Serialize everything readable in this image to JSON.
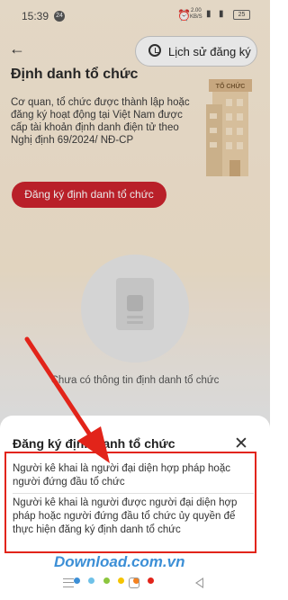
{
  "status_bar": {
    "time": "15:39",
    "notification_count": "24",
    "speed_value": "2.00",
    "speed_unit": "KB/S",
    "battery": "25"
  },
  "header": {
    "back_icon": "back-arrow-icon",
    "history_label": "Lịch sử đăng ký"
  },
  "page": {
    "title": "Định danh tổ chức",
    "description": "Cơ quan, tổ chức được thành lập hoặc đăng ký hoạt động tại Việt Nam được cấp tài khoản định danh điện tử theo Nghị định 69/2024/ NĐ-CP",
    "building_sign": "TỔ CHỨC",
    "register_button": "Đăng ký định danh tổ chức",
    "empty_text": "Chưa có thông tin định danh tổ chức"
  },
  "sheet": {
    "title": "Đăng ký định danh tổ chức",
    "options": [
      "Người kê khai là người đại diện hợp pháp hoặc người đứng đầu tổ chức",
      "Người kê khai là người được người đại diện hợp pháp hoặc người đứng đầu tổ chức ủy quyền để thực hiện đăng ký định danh tổ chức"
    ]
  },
  "watermark": {
    "text": "Download.com.vn",
    "dot_colors": [
      "#3c8fd6",
      "#6fc1e8",
      "#8cc63e",
      "#f5c400",
      "#f58220",
      "#e2241a"
    ]
  },
  "colors": {
    "accent": "#c9232d",
    "highlight": "#e2241a"
  }
}
